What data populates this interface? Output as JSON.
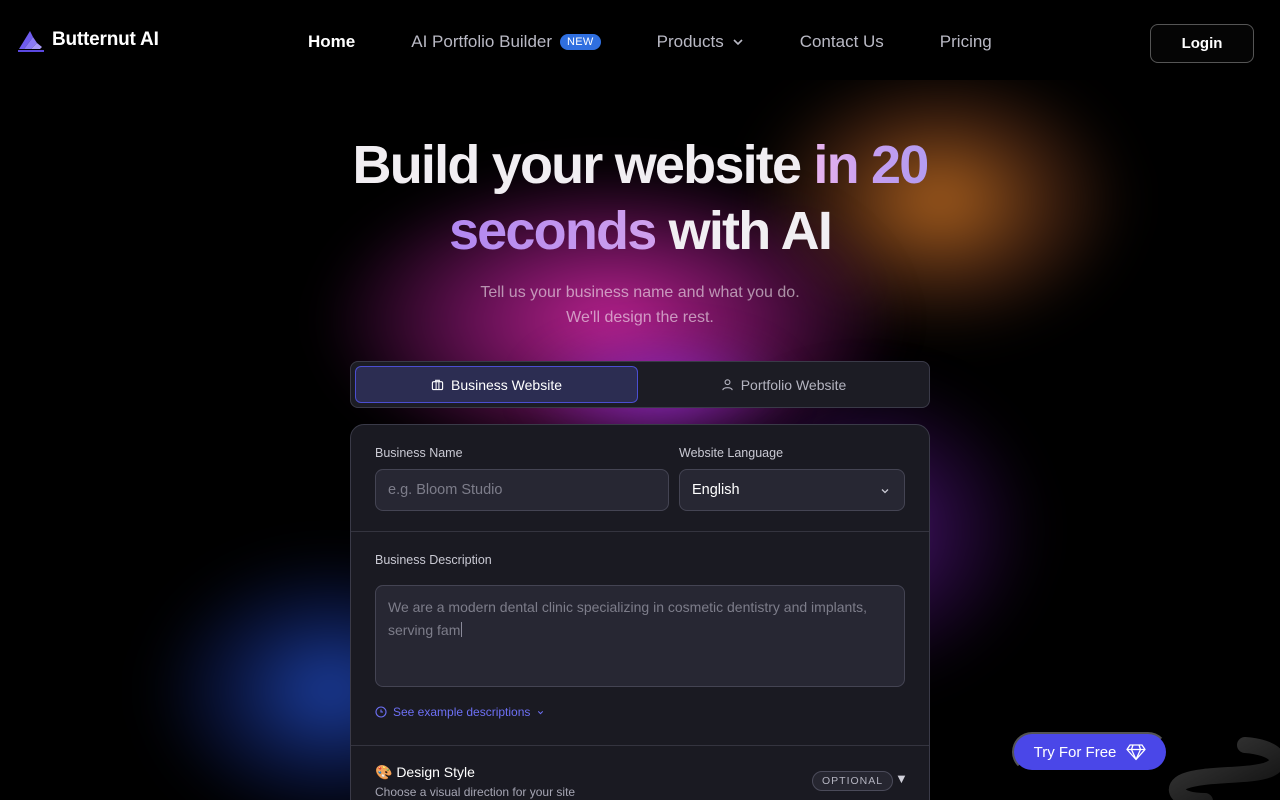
{
  "brand": {
    "name": "Butternut AI",
    "logo_icon": "butternut-logo"
  },
  "nav": {
    "items": [
      {
        "label": "Home",
        "active": true
      },
      {
        "label": "AI Portfolio Builder",
        "badge": "NEW"
      },
      {
        "label": "Products",
        "has_dropdown": true
      },
      {
        "label": "Contact Us"
      },
      {
        "label": "Pricing"
      }
    ],
    "login_label": "Login"
  },
  "hero": {
    "title_part1": "Build your website ",
    "title_highlight1": "in 20",
    "title_highlight2": "seconds",
    "title_part2": " with AI",
    "subtitle_line1": "Tell us your business name and what you do.",
    "subtitle_line2": "We'll design the rest."
  },
  "site_type": {
    "options": [
      {
        "label": "Business Website",
        "icon": "briefcase-icon",
        "selected": true
      },
      {
        "label": "Portfolio Website",
        "icon": "user-icon",
        "selected": false
      }
    ]
  },
  "form": {
    "business_name": {
      "label": "Business Name",
      "placeholder": "e.g. Bloom Studio",
      "value": ""
    },
    "language": {
      "label": "Website Language",
      "value": "English"
    },
    "description": {
      "label": "Business Description",
      "value": "We are a modern dental clinic specializing in cosmetic dentistry and implants, serving fam"
    },
    "examples_link": "See example descriptions",
    "design_style": {
      "title": "🎨 Design Style",
      "subtitle": "Choose a visual direction for your site",
      "badge": "OPTIONAL"
    }
  },
  "cta": {
    "label": "Try For Free",
    "icon": "diamond-icon"
  },
  "colors": {
    "accent": "#4a47e8",
    "badge_blue": "#2f6fe0",
    "link": "#6d70f5",
    "background": "#000000"
  }
}
